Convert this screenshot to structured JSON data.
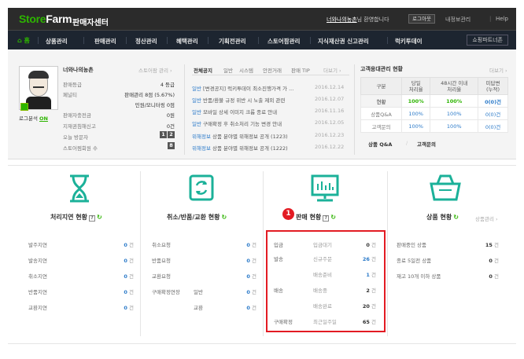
{
  "header": {
    "logo_store": "Store",
    "logo_farm": "Farm",
    "logo_sub": "판매자센터",
    "user_name": "너와나의농촌",
    "welcome_suffix": "님 환영합니다",
    "logout": "로그아웃",
    "my_info": "내정보관리",
    "help": "Help"
  },
  "nav": {
    "home": "홈",
    "items": [
      "상품관리",
      "판매관리",
      "정산관리",
      "혜택관리",
      "기획전관리",
      "스토어팜관리",
      "지식재산권 신고관리",
      "럭키투데이"
    ],
    "partner": "쇼핑파트너존"
  },
  "profile": {
    "store_name": "너와나의농촌",
    "store_info_link": "스토어팜 관리",
    "login_analysis_label": "로그분석",
    "login_analysis_state": "ON",
    "rows": [
      {
        "label": "판매등급",
        "value": "4 등급"
      },
      {
        "label": "굿서비스",
        "value": ""
      },
      {
        "label": "페널티",
        "value": "판매관리 8점 (5.67%)"
      },
      {
        "label": "",
        "value": "민원/모니터링 0점"
      },
      {
        "label": "판매자충전금",
        "value": "0원"
      },
      {
        "label": "지재권침해신고",
        "value": "0건"
      },
      {
        "label": "오늘 방문자",
        "value": "1 2"
      },
      {
        "label": "스토어찜회원 수",
        "value": "8"
      }
    ]
  },
  "notices": {
    "tabs": [
      "전체공지",
      "일반",
      "시스템",
      "안전거래",
      "판매 TIP"
    ],
    "more": "더보기",
    "items": [
      {
        "cat": "일반",
        "text": "[변경공지] 럭키투데이 최소진행가격 가 ...",
        "date": "2016.12.14"
      },
      {
        "cat": "일반",
        "text": "반품/환불 규정 위반 시 노출 제외 관련",
        "date": "2016.12.07"
      },
      {
        "cat": "일반",
        "text": "모바일 상세 이미지 크롭 종료 안내",
        "date": "2016.11.16"
      },
      {
        "cat": "일반",
        "text": "구매확정 후 취소처리 기능 변경 안내",
        "date": "2016.12.05"
      },
      {
        "cat": "위해정보",
        "text": "상품 분야별 위해정보 공개 (1223)",
        "date": "2016.12.23"
      },
      {
        "cat": "위해정보",
        "text": "상품 분야별 위해정보 공개 (1222)",
        "date": "2016.12.22"
      }
    ]
  },
  "cs": {
    "title": "고객응대관리 현황",
    "more": "더보기",
    "headers": [
      "구분",
      "당일\n처리율",
      "48시간 이내\n처리율",
      "미답변\n(누적)"
    ],
    "rows": [
      {
        "label": "현황",
        "v1": "100%",
        "v2": "100%",
        "v3": "0(0)건"
      },
      {
        "label": "상품Q&A",
        "v1": "100%",
        "v2": "100%",
        "v3": "0(0)건"
      },
      {
        "label": "고객문의",
        "v1": "100%",
        "v2": "100%",
        "v3": "0(0)건"
      }
    ],
    "footer_a": "상품 Q&A",
    "footer_b": "고객문의"
  },
  "delay": {
    "title": "처리지연 현황",
    "rows": [
      {
        "label": "발주지연",
        "count": "0",
        "unit": "건"
      },
      {
        "label": "발송지연",
        "count": "0",
        "unit": "건"
      },
      {
        "label": "취소지연",
        "count": "0",
        "unit": "건"
      },
      {
        "label": "반품지연",
        "count": "0",
        "unit": "건"
      },
      {
        "label": "교환지연",
        "count": "0",
        "unit": "건"
      }
    ]
  },
  "claims": {
    "title": "취소/반품/교환 현황",
    "rows": [
      {
        "label": "취소요청",
        "sub": "",
        "count": "0",
        "unit": "건"
      },
      {
        "label": "반품요청",
        "sub": "",
        "count": "0",
        "unit": "건"
      },
      {
        "label": "교환요청",
        "sub": "",
        "count": "0",
        "unit": "건"
      },
      {
        "label": "구매확정연장",
        "sub": "일반",
        "count": "0",
        "unit": "건"
      },
      {
        "label": "",
        "sub": "교환",
        "count": "0",
        "unit": "건"
      }
    ]
  },
  "sales": {
    "title": "판매 현황",
    "badge": "1",
    "rows": [
      {
        "group": "입금",
        "label": "입금대기",
        "count": "0",
        "unit": "건"
      },
      {
        "group": "발송",
        "label": "신규주문",
        "count": "26",
        "unit": "건"
      },
      {
        "group": "",
        "label": "배송준비",
        "count": "1",
        "unit": "건"
      },
      {
        "group": "배송",
        "label": "배송중",
        "count": "2",
        "unit": "건"
      },
      {
        "group": "",
        "label": "배송완료",
        "count": "20",
        "unit": "건"
      },
      {
        "group": "구매확정",
        "label": "최근일주일",
        "count": "65",
        "unit": "건"
      }
    ]
  },
  "products": {
    "title": "상품 현황",
    "manage": "상품관리",
    "rows": [
      {
        "label": "판매중인 상품",
        "count": "15",
        "unit": "건"
      },
      {
        "label": "종료 5일전 상품",
        "count": "0",
        "unit": "건"
      },
      {
        "label": "재고 10개 이하 상품",
        "count": "0",
        "unit": "건"
      }
    ]
  }
}
